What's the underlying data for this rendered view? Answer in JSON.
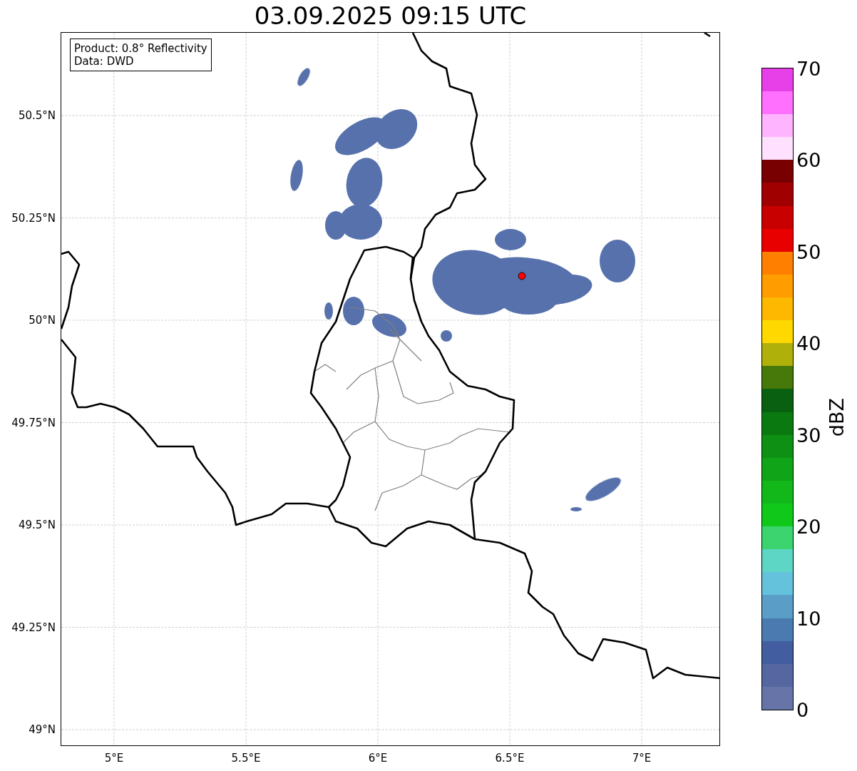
{
  "title": "03.09.2025 09:15 UTC",
  "info_box": {
    "lines": [
      "Product: 0.8° Reflectivity",
      "Data: DWD"
    ]
  },
  "map": {
    "lat_labels": [
      "50.5°N",
      "50.25°N",
      "50°N",
      "49.75°N",
      "49.5°N",
      "49.25°N",
      "49°N"
    ],
    "lon_labels": [
      "5°E",
      "5.5°E",
      "6°E",
      "6.5°E",
      "7°E"
    ]
  },
  "colorbar": {
    "label": "dBZ",
    "ticks": [
      "70",
      "60",
      "50",
      "40",
      "30",
      "20",
      "10",
      "0"
    ],
    "bands": [
      {
        "color": "#6674a8"
      },
      {
        "color": "#5666a0"
      },
      {
        "color": "#425ea0"
      },
      {
        "color": "#4a7ab0"
      },
      {
        "color": "#5a9ec8"
      },
      {
        "color": "#64c2dc"
      },
      {
        "color": "#5ed6c6"
      },
      {
        "color": "#3cd46e"
      },
      {
        "color": "#10c81a"
      },
      {
        "color": "#12b81a"
      },
      {
        "color": "#10a418"
      },
      {
        "color": "#0e9014"
      },
      {
        "color": "#0a7a10"
      },
      {
        "color": "#086010"
      },
      {
        "color": "#46780a"
      },
      {
        "color": "#b0b00a"
      },
      {
        "color": "#ffd800"
      },
      {
        "color": "#ffb800"
      },
      {
        "color": "#ff9c00"
      },
      {
        "color": "#ff8000"
      },
      {
        "color": "#e80000"
      },
      {
        "color": "#c80000"
      },
      {
        "color": "#a00000"
      },
      {
        "color": "#780000"
      },
      {
        "color": "#ffe0ff"
      },
      {
        "color": "#ffb4ff"
      },
      {
        "color": "#ff70ff"
      },
      {
        "color": "#e840e8"
      }
    ]
  }
}
